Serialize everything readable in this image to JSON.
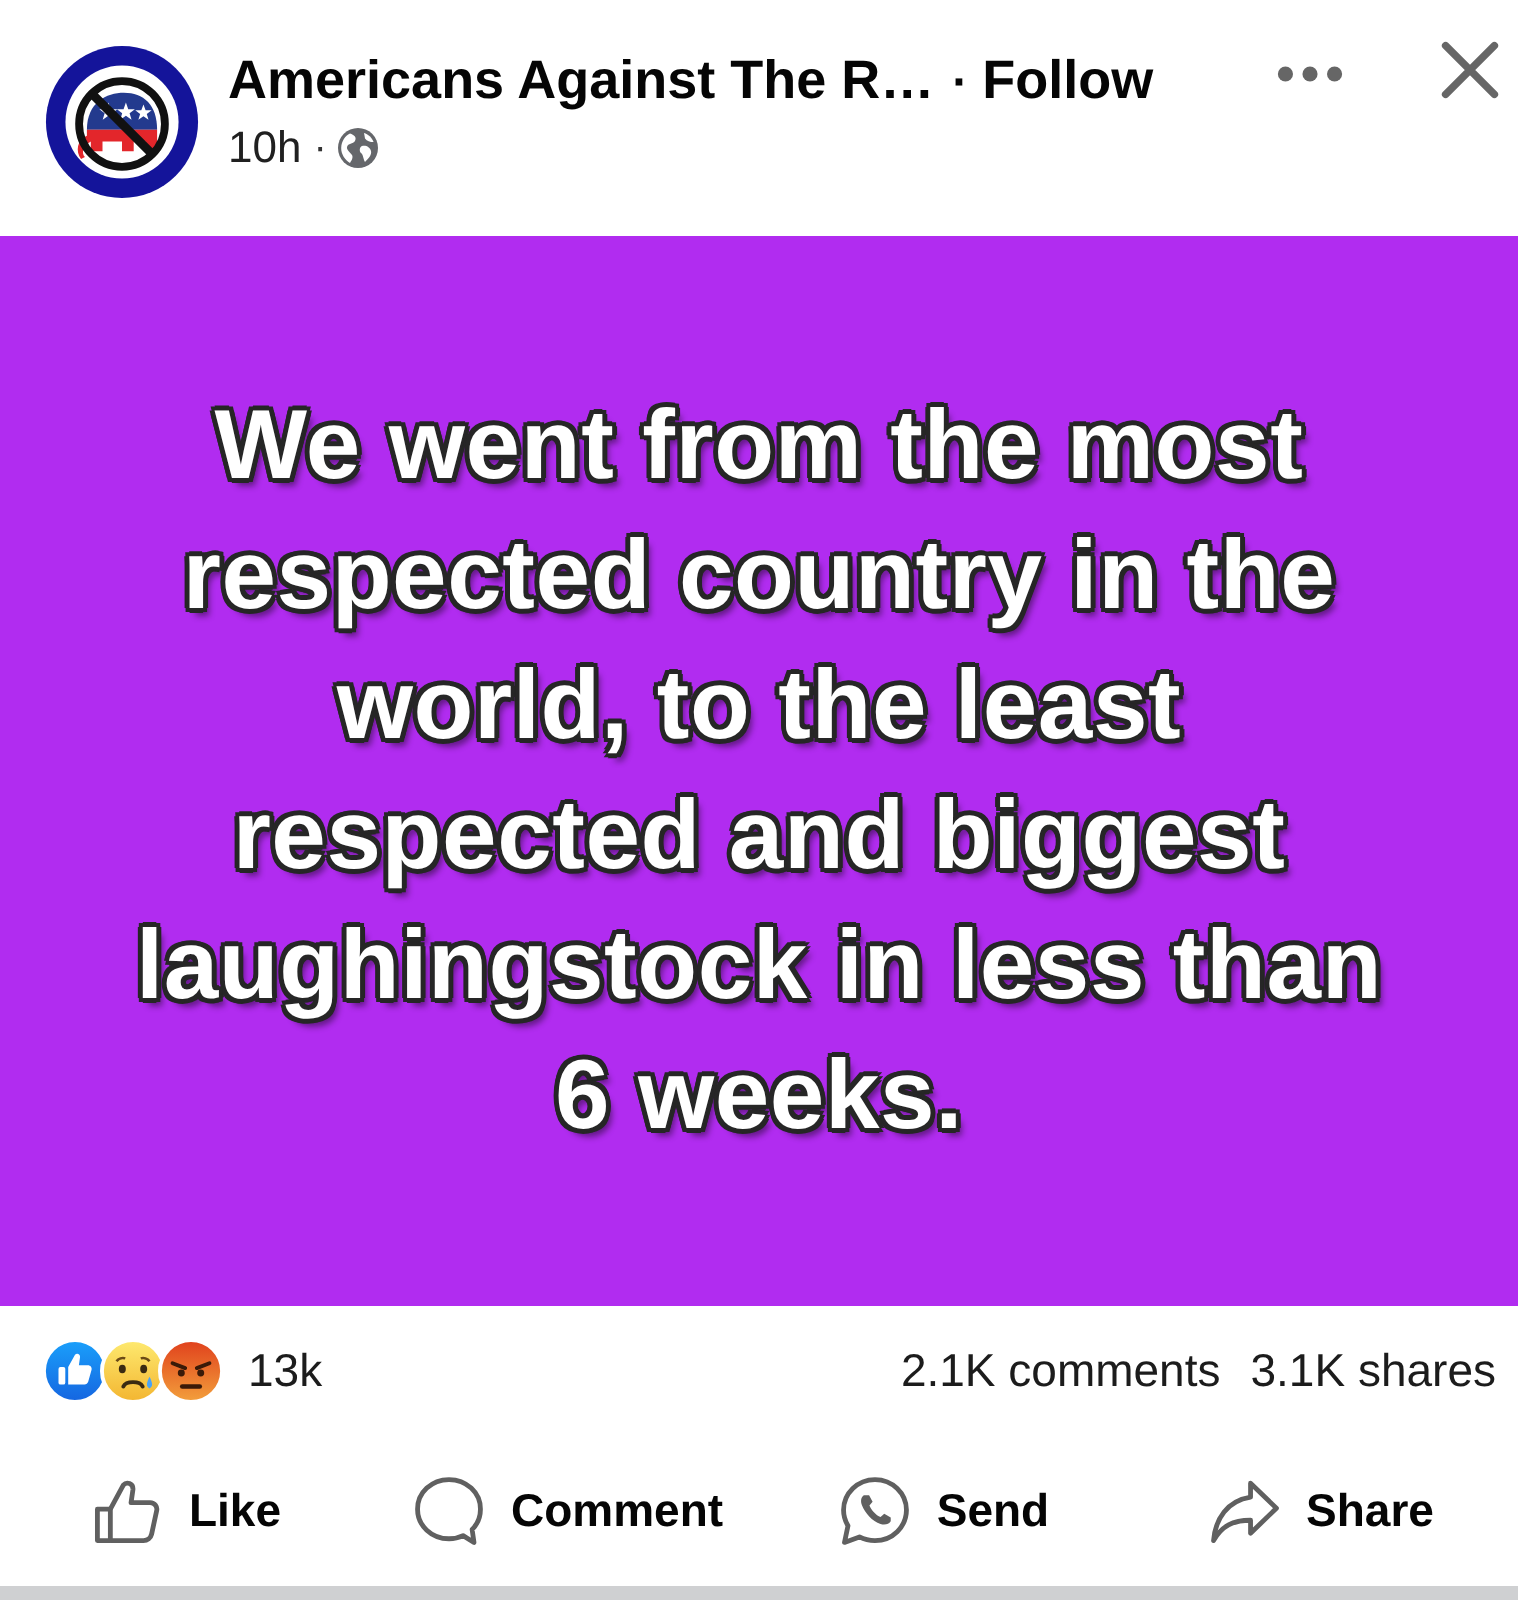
{
  "header": {
    "page_name": "Americans Against The R…",
    "name_separator": "·",
    "follow": "Follow",
    "time": "10h",
    "time_separator": "·"
  },
  "post": {
    "text": "We went from the most respected country in the world, to the least respected and biggest laughingstock in less than 6 weeks."
  },
  "stats": {
    "reactions": [
      {
        "kind": "like"
      },
      {
        "kind": "sad"
      },
      {
        "kind": "angry"
      }
    ],
    "reaction_count": "13k",
    "comments": "2.1K comments",
    "shares": "3.1K shares"
  },
  "actions": [
    {
      "kind": "like",
      "label": "Like"
    },
    {
      "kind": "comment",
      "label": "Comment"
    },
    {
      "kind": "send",
      "label": "Send"
    },
    {
      "kind": "share",
      "label": "Share"
    }
  ]
}
